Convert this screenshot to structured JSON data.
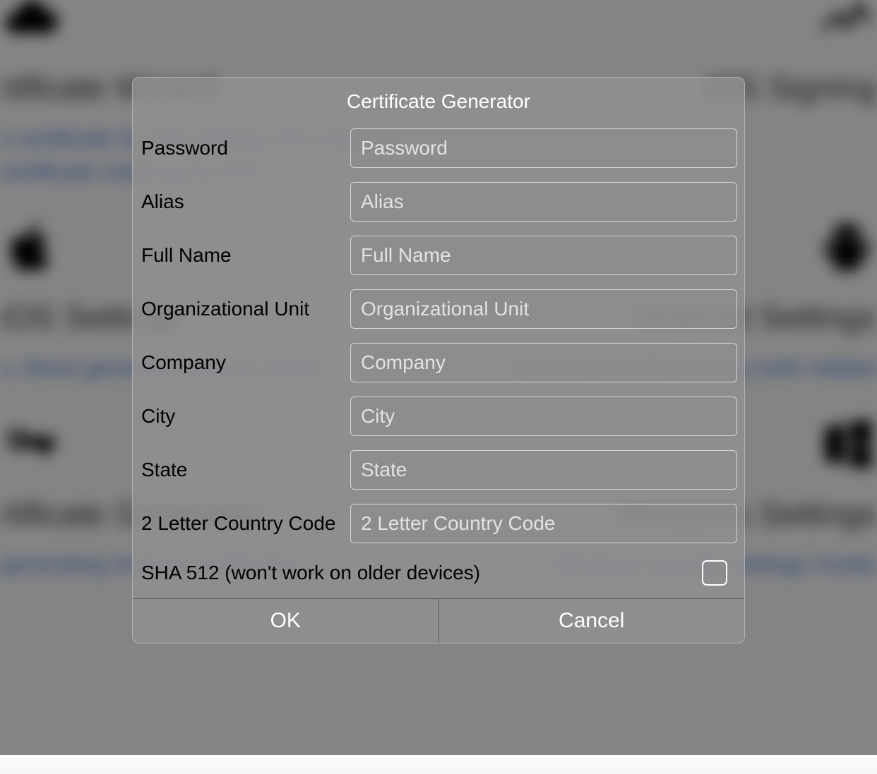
{
  "dialog": {
    "title": "Certificate Generator",
    "fields": {
      "password": {
        "label": "Password",
        "placeholder": "Password",
        "value": ""
      },
      "alias": {
        "label": "Alias",
        "placeholder": "Alias",
        "value": ""
      },
      "fullName": {
        "label": "Full Name",
        "placeholder": "Full Name",
        "value": ""
      },
      "orgUnit": {
        "label": "Organizational Unit",
        "placeholder": "Organizational Unit",
        "value": ""
      },
      "company": {
        "label": "Company",
        "placeholder": "Company",
        "value": ""
      },
      "city": {
        "label": "City",
        "placeholder": "City",
        "value": ""
      },
      "state": {
        "label": "State",
        "placeholder": "State",
        "value": ""
      },
      "countryCode": {
        "label": "2 Letter Country Code",
        "placeholder": "2 Letter Country Code",
        "value": ""
      }
    },
    "sha512": {
      "label": "SHA 512 (won't work on older devices)",
      "checked": false
    },
    "buttons": {
      "ok": "OK",
      "cancel": "Cancel"
    }
  },
  "background": {
    "topLeft": {
      "heading": "rtificate Wizard",
      "text": "s certificate for iOS signing, this enables certificate ordering for iOS.",
      "text2": "ly by using Codename Signing servers"
    },
    "topRight": {
      "heading": "iOS Signing"
    },
    "midLeft": {
      "heading": "iOS Settings",
      "text": "s, these generally need to match"
    },
    "midRight": {
      "heading": "Android Settings",
      "text": "Android specific settings both related"
    },
    "bottomLeft": {
      "heading": "rtificate Generator",
      "text": "generating Android certificates"
    },
    "bottomRight": {
      "heading": "Windows Settings",
      "text": "Windows specific settings mostly"
    }
  }
}
